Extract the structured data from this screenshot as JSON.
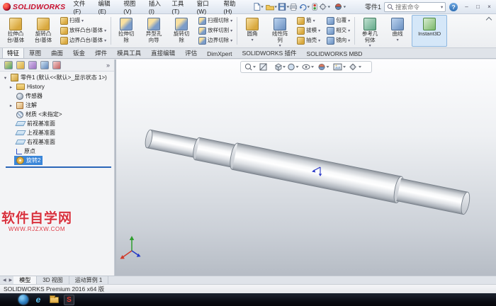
{
  "colors": {
    "accent_blue": "#3a86d9",
    "logo_red": "#c8102e",
    "selection": "#3a86d9",
    "taskbar_bg": "#0b0d14",
    "watermark_red": "#d8333f"
  },
  "titlebar": {
    "logo_name": "SOLIDWORKS",
    "doc_title": "零件1",
    "search_placeholder": "搜索命令",
    "help_glyph": "?",
    "menus": [
      {
        "name": "file",
        "label": "文件(F)"
      },
      {
        "name": "edit",
        "label": "编辑(E)"
      },
      {
        "name": "view",
        "label": "视图(V)"
      },
      {
        "name": "insert",
        "label": "插入(I)"
      },
      {
        "name": "tools",
        "label": "工具(T)"
      },
      {
        "name": "window",
        "label": "窗口(W)"
      },
      {
        "name": "help",
        "label": "帮助(H)"
      }
    ],
    "quick_tools": [
      "new-document",
      "open-document",
      "save-document",
      "print-document",
      "undo",
      "rebuild",
      "options",
      "edit-appearance"
    ],
    "window_controls": [
      {
        "name": "minimize",
        "glyph": "–"
      },
      {
        "name": "maximize",
        "glyph": "□"
      },
      {
        "name": "close",
        "glyph": "×"
      }
    ]
  },
  "ribbon": {
    "items": [
      {
        "kind": "big",
        "name": "extruded-boss-base",
        "lines": [
          "拉伸凸",
          "台/基体"
        ],
        "arrow": false
      },
      {
        "kind": "big",
        "name": "revolved-boss-base",
        "lines": [
          "旋转凸",
          "台/基体"
        ],
        "arrow": false
      },
      {
        "kind": "stack",
        "buttons": [
          {
            "name": "swept-boss-base",
            "label": "扫描"
          },
          {
            "name": "lofted-boss-base",
            "label": "放样凸台/基体"
          },
          {
            "name": "boundary-boss-base",
            "label": "边界凸台/基体"
          }
        ]
      },
      {
        "kind": "sep"
      },
      {
        "kind": "big",
        "name": "extruded-cut",
        "lines": [
          "拉伸切",
          "除"
        ],
        "arrow": false
      },
      {
        "kind": "big",
        "name": "hole-wizard",
        "lines": [
          "异型孔",
          "向导"
        ],
        "arrow": false
      },
      {
        "kind": "big",
        "name": "revolved-cut",
        "lines": [
          "旋转切",
          "除"
        ],
        "arrow": false
      },
      {
        "kind": "stack",
        "buttons": [
          {
            "name": "swept-cut",
            "label": "扫描切除"
          },
          {
            "name": "lofted-cut",
            "label": "放样切割"
          },
          {
            "name": "boundary-cut",
            "label": "边界切除"
          }
        ]
      },
      {
        "kind": "sep"
      },
      {
        "kind": "big",
        "name": "fillet",
        "lines": [
          "圆角"
        ],
        "arrow": true
      },
      {
        "kind": "big",
        "name": "linear-pattern",
        "lines": [
          "线性阵",
          "列"
        ],
        "arrow": true
      },
      {
        "kind": "stack",
        "buttons": [
          {
            "name": "rib",
            "label": "筋"
          },
          {
            "name": "draft",
            "label": "拔模"
          },
          {
            "name": "shell",
            "label": "抽壳"
          }
        ]
      },
      {
        "kind": "stack",
        "buttons": [
          {
            "name": "wrap",
            "label": "包覆"
          },
          {
            "name": "intersect",
            "label": "相交"
          },
          {
            "name": "mirror",
            "label": "镜向"
          }
        ]
      },
      {
        "kind": "sep"
      },
      {
        "kind": "big",
        "name": "reference-geometry",
        "lines": [
          "参考几",
          "何体"
        ],
        "arrow": true
      },
      {
        "kind": "big",
        "name": "curves",
        "lines": [
          "曲线"
        ],
        "arrow": true
      },
      {
        "kind": "big",
        "name": "instant3d",
        "lines": [
          "Instant3D"
        ],
        "arrow": false,
        "pressed": true,
        "wide": true
      }
    ],
    "tabs": [
      {
        "name": "features",
        "label": "特征",
        "active": true
      },
      {
        "name": "sketch",
        "label": "草图",
        "active": false
      },
      {
        "name": "surfaces",
        "label": "曲面",
        "active": false
      },
      {
        "name": "sheet-metal",
        "label": "钣金",
        "active": false
      },
      {
        "name": "weldments",
        "label": "焊件",
        "active": false
      },
      {
        "name": "mold-tools",
        "label": "模具工具",
        "active": false
      },
      {
        "name": "direct-editing",
        "label": "直接编辑",
        "active": false
      },
      {
        "name": "evaluate",
        "label": "评估",
        "active": false
      },
      {
        "name": "dimxpert",
        "label": "DimXpert",
        "active": false
      },
      {
        "name": "solidworks-addins",
        "label": "SOLIDWORKS 插件",
        "active": false
      },
      {
        "name": "solidworks-mbd",
        "label": "SOLIDWORKS MBD",
        "active": false
      }
    ]
  },
  "panel": {
    "manager_tabs": [
      "feature-manager-tab",
      "property-manager-tab",
      "configuration-manager-tab",
      "dimxpert-manager-tab",
      "display-manager-tab"
    ],
    "expand_glyph": "»",
    "tree": {
      "root_label": "零件1 (默认<<默认>_显示状态 1>)",
      "root_arrow": "▾",
      "items": [
        {
          "name": "history",
          "label": "History",
          "icon": "folder",
          "arrow": "▸",
          "selected": false
        },
        {
          "name": "sensors",
          "label": "传感器",
          "icon": "sensor",
          "arrow": "",
          "selected": false
        },
        {
          "name": "annotations",
          "label": "注解",
          "icon": "annotation",
          "arrow": "▸",
          "selected": false
        },
        {
          "name": "material",
          "label": "材质 <未指定>",
          "icon": "material",
          "arrow": "",
          "selected": false
        },
        {
          "name": "front-plane",
          "label": "前视基准面",
          "icon": "plane",
          "arrow": "",
          "selected": false
        },
        {
          "name": "top-plane",
          "label": "上视基准面",
          "icon": "plane",
          "arrow": "",
          "selected": false
        },
        {
          "name": "right-plane",
          "label": "右视基准面",
          "icon": "plane",
          "arrow": "",
          "selected": false
        },
        {
          "name": "origin",
          "label": "原点",
          "icon": "origin",
          "arrow": "",
          "selected": false
        },
        {
          "name": "revolve2",
          "label": "旋转2",
          "icon": "revolve",
          "arrow": "",
          "selected": true
        }
      ]
    }
  },
  "headsup_icons": [
    "zoom-fit",
    "section-view",
    "view-orientation",
    "display-style",
    "hide-show-items",
    "edit-appearance",
    "apply-scene",
    "view-settings"
  ],
  "viewport": {
    "model_name": "stepped-shaft",
    "watermark_title": "软件自学网",
    "watermark_url": "WWW.RJZXW.COM"
  },
  "doc_tabs": {
    "nav": [
      {
        "name": "scroll-tabs-left",
        "glyph": "◀"
      },
      {
        "name": "scroll-tabs-right",
        "glyph": "▶"
      }
    ],
    "tabs": [
      {
        "name": "model",
        "label": "模型",
        "active": true
      },
      {
        "name": "3d-views",
        "label": "3D 视图",
        "active": false
      },
      {
        "name": "motion-study-1",
        "label": "运动算例 1",
        "active": false
      }
    ]
  },
  "statusbar": {
    "text": "SOLIDWORKS Premium 2016 x64 版"
  },
  "taskbar": {
    "icons": [
      {
        "name": "start-button",
        "glyph": ""
      },
      {
        "name": "internet-explorer-icon",
        "glyph": "e"
      },
      {
        "name": "file-explorer-icon",
        "glyph": ""
      },
      {
        "name": "solidworks-taskbar-icon",
        "glyph": "S"
      }
    ]
  }
}
